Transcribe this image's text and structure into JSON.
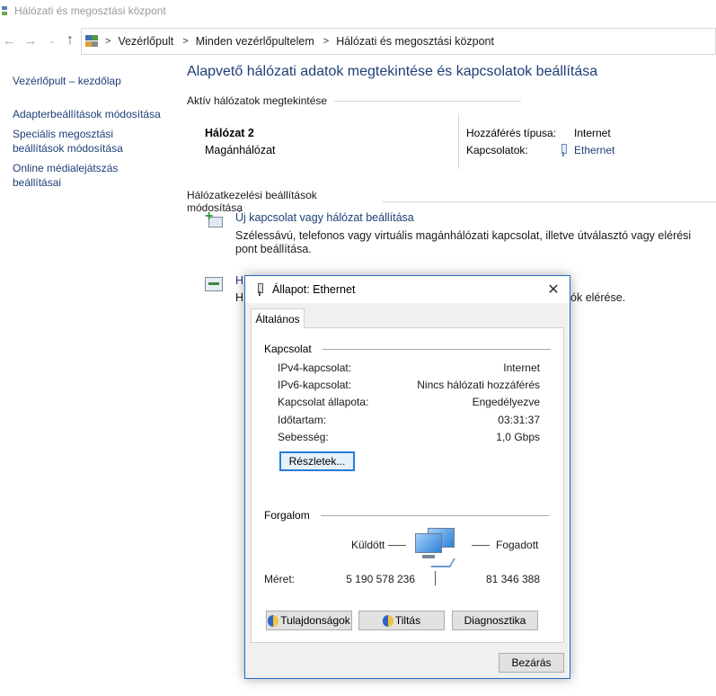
{
  "window": {
    "title": "Hálózati és megosztási központ"
  },
  "nav": {
    "back": "←",
    "forward": "→",
    "recent": "⌄",
    "up": "↑"
  },
  "breadcrumb": [
    "Vezérlőpult",
    "Minden vezérlőpultelem",
    "Hálózati és megosztási központ"
  ],
  "leftnav": {
    "home": "Vezérlőpult – kezdőlap",
    "adapter": "Adapterbeállítások módosítása",
    "sharing": "Speciális megosztási beállítások módosítása",
    "media": "Online médialejátszás beállításai"
  },
  "main": {
    "title": "Alapvető hálózati adatok megtekintése és kapcsolatok beállítása",
    "active_heading": "Aktív hálózatok megtekintése",
    "network": {
      "name": "Hálózat  2",
      "type": "Magánhálózat",
      "access_label": "Hozzáférés típusa:",
      "access_value": "Internet",
      "connections_label": "Kapcsolatok:",
      "connections_value": "Ethernet"
    },
    "manage_heading": "Hálózatkezelési beállítások módosítása",
    "tasks": [
      {
        "link": "Új kapcsolat vagy hálózat beállítása",
        "desc": "Szélessávú, telefonos vagy virtuális magánhálózati kapcsolat, illetve útválasztó vagy elérési pont beállítása."
      },
      {
        "link": "H",
        "desc": "H",
        "desc_tail": "ók elérése."
      }
    ]
  },
  "dialog": {
    "title": "Állapot: Ethernet",
    "close": "✕",
    "tab": "Általános",
    "connection_heading": "Kapcsolat",
    "rows": [
      {
        "label": "IPv4-kapcsolat:",
        "value": "Internet"
      },
      {
        "label": "IPv6-kapcsolat:",
        "value": "Nincs hálózati hozzáférés"
      },
      {
        "label": "Kapcsolat állapota:",
        "value": "Engedélyezve"
      },
      {
        "label": "Időtartam:",
        "value": "03:31:37"
      },
      {
        "label": "Sebesség:",
        "value": "1,0 Gbps"
      }
    ],
    "details_button": "Részletek...",
    "traffic_heading": "Forgalom",
    "sent_label": "Küldött",
    "received_label": "Fogadott",
    "size_label": "Méret:",
    "sent_value": "5 190 578 236",
    "received_value": "81 346 388",
    "properties_button": "Tulajdonságok",
    "disable_button": "Tiltás",
    "diagnose_button": "Diagnosztika",
    "close_button": "Bezárás"
  },
  "colors": {
    "link": "#1e3f78",
    "dialog_border": "#1f6fc0",
    "focus": "#2a7bd4"
  }
}
